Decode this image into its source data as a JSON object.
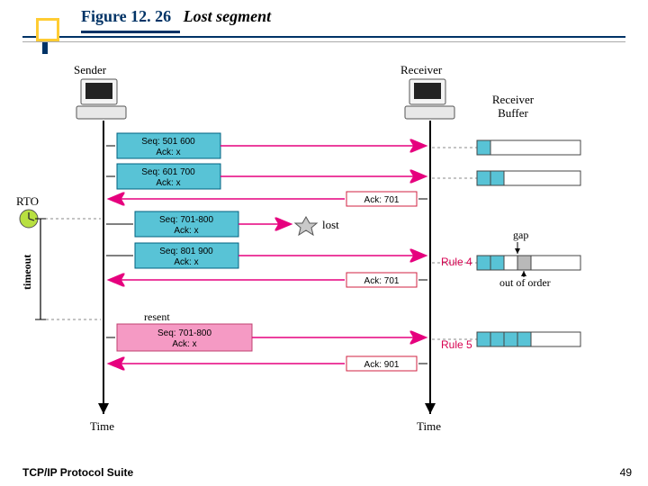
{
  "title": {
    "prefix": "Figure 12. 26",
    "text": "Lost segment"
  },
  "header": {
    "sender": "Sender",
    "receiver": "Receiver",
    "buffer_label_1": "Receiver",
    "buffer_label_2": "Buffer"
  },
  "labels": {
    "rto": "RTO",
    "timeout": "timeout",
    "lost": "lost",
    "resent": "resent",
    "time": "Time",
    "gap": "gap",
    "ooo": "out of order"
  },
  "segments": {
    "s1a": "Seq: 501 600",
    "s1b": "Ack: x",
    "s2a": "Seq: 601 700",
    "s2b": "Ack: x",
    "s3a": "Seq: 701-800",
    "s3b": "Ack: x",
    "s4a": "Seq: 801 900",
    "s4b": "Ack: x",
    "s5a": "Seq: 701-800",
    "s5b": "Ack: x"
  },
  "acks": {
    "a1": "Ack: 701",
    "a2": "Ack: 701",
    "a3": "Ack: 901"
  },
  "rules": {
    "r4": "Rule 4",
    "r5": "Rule 5"
  },
  "footer": "TCP/IP Protocol Suite",
  "page": "49",
  "chart_data": {
    "type": "table",
    "title": "TCP Lost segment retransmission timeline",
    "events": [
      {
        "dir": "S→R",
        "seq": "501-600",
        "ack": "x",
        "delivered": true
      },
      {
        "dir": "S→R",
        "seq": "601-700",
        "ack": "x",
        "delivered": true
      },
      {
        "dir": "R→S",
        "ack_no": 701
      },
      {
        "dir": "S→R",
        "seq": "701-800",
        "ack": "x",
        "delivered": false,
        "status": "lost"
      },
      {
        "dir": "S→R",
        "seq": "801-900",
        "ack": "x",
        "delivered": true,
        "note": "creates gap"
      },
      {
        "dir": "R→S",
        "ack_no": 701,
        "rule": "Rule 4"
      },
      {
        "event": "RTO timeout"
      },
      {
        "dir": "S→R",
        "seq": "701-800",
        "ack": "x",
        "delivered": true,
        "status": "resent"
      },
      {
        "dir": "R→S",
        "ack_no": 901,
        "rule": "Rule 5"
      }
    ]
  }
}
